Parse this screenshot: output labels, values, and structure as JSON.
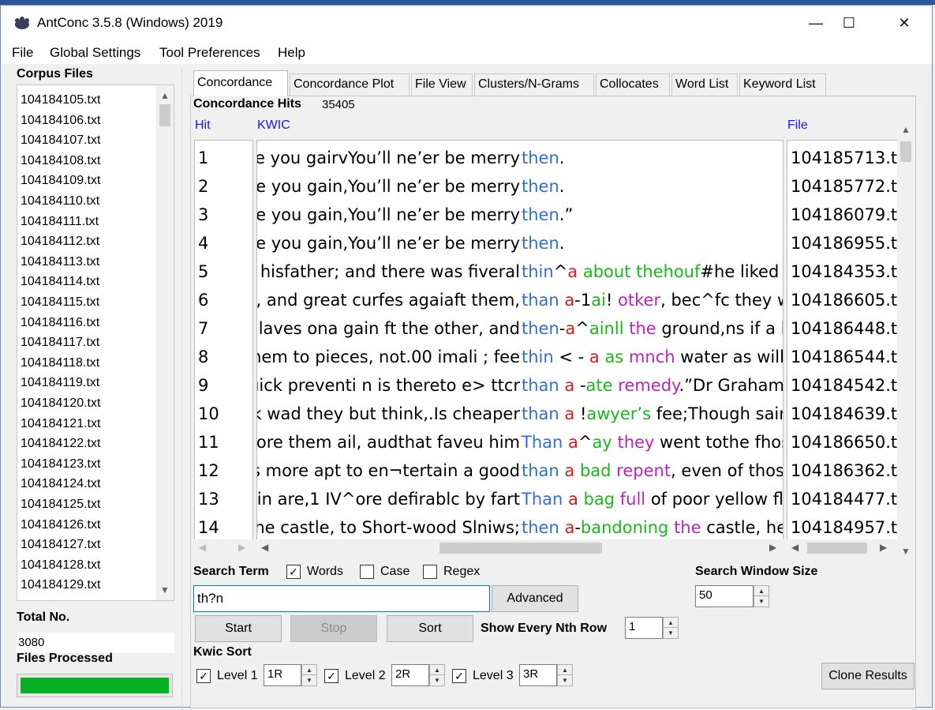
{
  "window": {
    "title": "AntConc 3.5.8 (Windows) 2019",
    "minimize": "—",
    "maximize": "☐",
    "close": "✕"
  },
  "menu": [
    "File",
    "Global Settings",
    "Tool Preferences",
    "Help"
  ],
  "corpus": {
    "label": "Corpus Files",
    "files": [
      "104184105.txt",
      "104184106.txt",
      "104184107.txt",
      "104184108.txt",
      "104184109.txt",
      "104184110.txt",
      "104184111.txt",
      "104184112.txt",
      "104184113.txt",
      "104184114.txt",
      "104184115.txt",
      "104184116.txt",
      "104184117.txt",
      "104184118.txt",
      "104184119.txt",
      "104184120.txt",
      "104184121.txt",
      "104184122.txt",
      "104184123.txt",
      "104184124.txt",
      "104184125.txt",
      "104184126.txt",
      "104184127.txt",
      "104184128.txt",
      "104184129.txt"
    ],
    "total_label": "Total No.",
    "total_value": "3080",
    "processed_label": "Files Processed",
    "processed_progress": 1.0
  },
  "tabs": [
    "Concordance",
    "Concordance Plot",
    "File View",
    "Clusters/N-Grams",
    "Collocates",
    "Word List",
    "Keyword List"
  ],
  "concordance": {
    "hits_label": "Concordance Hits",
    "hits_count": "35405",
    "col_hit": "Hit",
    "col_kwic": "KWIC",
    "col_file": "File",
    "rows": [
      {
        "hit": "1",
        "left": "e you gairvYou’ll ne’er be merry",
        "right": [
          [
            "then",
            "blue"
          ],
          [
            ".",
            "black"
          ]
        ],
        "file": "104185713.t"
      },
      {
        "hit": "2",
        "left": "e you gain,You’ll ne’er be merry",
        "right": [
          [
            "then",
            "blue"
          ],
          [
            ".",
            "black"
          ]
        ],
        "file": "104185772.t"
      },
      {
        "hit": "3",
        "left": "e you gain,You’ll ne’er be merry",
        "right": [
          [
            "then",
            "blue"
          ],
          [
            ".”",
            "black"
          ]
        ],
        "file": "104186079.t"
      },
      {
        "hit": "4",
        "left": "e you gain,You’ll ne’er be merry",
        "right": [
          [
            "then",
            "blue"
          ],
          [
            ".",
            "black"
          ]
        ],
        "file": "104186955.t"
      },
      {
        "hit": "5",
        "left": " hisfather; and there was fiveral",
        "right": [
          [
            "thin",
            "blue"
          ],
          [
            "^",
            "black"
          ],
          [
            "a",
            "red"
          ],
          [
            " about thehouf",
            "green"
          ],
          [
            "#he liked b",
            "black"
          ]
        ],
        "file": "104184353.t"
      },
      {
        "hit": "6",
        "left": "s, and great curfes agaiaft them,",
        "right": [
          [
            "than",
            "blue"
          ],
          [
            " a",
            "red"
          ],
          [
            "-1",
            "black"
          ],
          [
            "ai",
            "green"
          ],
          [
            "! ",
            "black"
          ],
          [
            "otker",
            "pink"
          ],
          [
            ", bec^fc they we",
            "black"
          ]
        ],
        "file": "104186605.t"
      },
      {
        "hit": "7",
        "left": "(laves ona gain ft the other, and",
        "right": [
          [
            "then",
            "blue"
          ],
          [
            "-",
            "black"
          ],
          [
            "a",
            "red"
          ],
          [
            "^",
            "black"
          ],
          [
            "ainll",
            "green"
          ],
          [
            " the",
            "pink"
          ],
          [
            " ground,ns if a h",
            "black"
          ]
        ],
        "file": "104186448.t"
      },
      {
        "hit": "8",
        "left": "hem to pieces, not.00 imali ; fee",
        "right": [
          [
            "thin",
            "blue"
          ],
          [
            " < - ",
            "black"
          ],
          [
            "a",
            "red"
          ],
          [
            " as",
            "green"
          ],
          [
            " mnch",
            "pink"
          ],
          [
            " water as will c",
            "black"
          ]
        ],
        "file": "104186544.t"
      },
      {
        "hit": "9",
        "left": "uick preventi n is thereto e> ttcr",
        "right": [
          [
            "than",
            "blue"
          ],
          [
            " a",
            "red"
          ],
          [
            " -",
            "black"
          ],
          [
            "ate",
            "green"
          ],
          [
            " remedy",
            "pink"
          ],
          [
            ".”Dr Graham",
            "black"
          ]
        ],
        "file": "104184542.t"
      },
      {
        "hit": "10",
        "left": "k wad they but think,.Is cheaper",
        "right": [
          [
            "than",
            "blue"
          ],
          [
            " a",
            "red"
          ],
          [
            " !",
            "black"
          ],
          [
            "awyer’s",
            "green"
          ],
          [
            " fee;Though sairly",
            "black"
          ]
        ],
        "file": "104184639.t"
      },
      {
        "hit": "11",
        "left": "ore them ail, audthat faveu him",
        "right": [
          [
            "Than",
            "blue"
          ],
          [
            " a",
            "red"
          ],
          [
            "^",
            "black"
          ],
          [
            "ay",
            "green"
          ],
          [
            " they",
            "pink"
          ],
          [
            " went tothe fhosr",
            "black"
          ]
        ],
        "file": "104186650.t"
      },
      {
        "hit": "12",
        "left": "s more apt to en¬tertain a good",
        "right": [
          [
            "than",
            "blue"
          ],
          [
            " a",
            "red"
          ],
          [
            " bad",
            "green"
          ],
          [
            " repent",
            "pink"
          ],
          [
            ", even of those",
            "black"
          ]
        ],
        "file": "104186362.t"
      },
      {
        "hit": "13",
        "left": "in are,1 IV^ore defirablc by fart",
        "right": [
          [
            "Than",
            "blue"
          ],
          [
            " a",
            "red"
          ],
          [
            " bag",
            "green"
          ],
          [
            " full",
            "pink"
          ],
          [
            " of poor yellow fla",
            "black"
          ]
        ],
        "file": "104184477.t"
      },
      {
        "hit": "14",
        "left": "he castle, to Short-wood Slniws;",
        "right": [
          [
            "then",
            "blue"
          ],
          [
            " a",
            "red"
          ],
          [
            "-",
            "black"
          ],
          [
            "bandoning",
            "green"
          ],
          [
            " the",
            "pink"
          ],
          [
            " castle, he",
            "black"
          ]
        ],
        "file": "104184957.t"
      }
    ]
  },
  "search": {
    "label": "Search Term",
    "words_label": "Words",
    "words_checked": true,
    "case_label": "Case",
    "case_checked": false,
    "regex_label": "Regex",
    "regex_checked": false,
    "term": "th?n",
    "advanced_label": "Advanced",
    "start_label": "Start",
    "stop_label": "Stop",
    "sort_label": "Sort",
    "nth_row_label": "Show Every Nth Row",
    "nth_row_value": "1",
    "window_size_label": "Search Window Size",
    "window_size_value": "50"
  },
  "kwic_sort": {
    "label": "Kwic Sort",
    "levels": [
      {
        "label": "Level 1",
        "value": "1R",
        "checked": true
      },
      {
        "label": "Level 2",
        "value": "2R",
        "checked": true
      },
      {
        "label": "Level 3",
        "value": "3R",
        "checked": true
      }
    ],
    "clone_label": "Clone Results"
  },
  "colors": {
    "keyword": "#2f6fd6",
    "r1": "#e01818",
    "r2": "#18b818",
    "r3": "#c020c0",
    "progress": "#06b025",
    "header_blue": "#1515ff"
  },
  "icons": {
    "check": "✓",
    "up": "▲",
    "down": "▼",
    "left": "◀",
    "right": "▶"
  }
}
